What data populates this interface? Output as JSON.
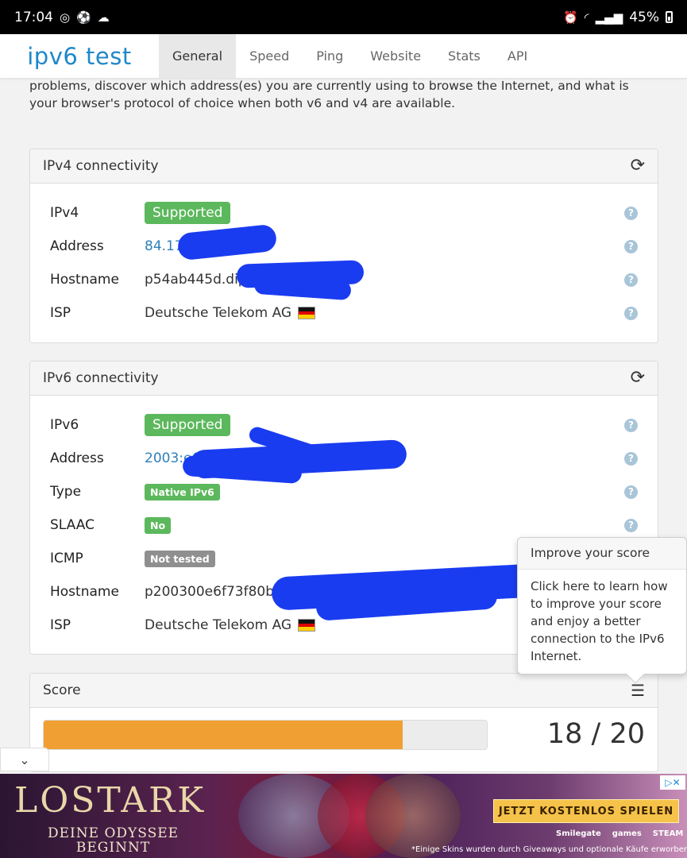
{
  "status": {
    "time": "17:04",
    "battery": "45%"
  },
  "nav": {
    "logo": "ipv6 test",
    "tabs": [
      "General",
      "Speed",
      "Ping",
      "Website",
      "Stats",
      "API"
    ],
    "active_tab": "General"
  },
  "intro": "problems, discover which address(es) you are currently using to browse the Internet, and what is your browser's protocol of choice when both v6 and v4 are available.",
  "ipv4": {
    "title": "IPv4 connectivity",
    "rows": [
      {
        "label": "IPv4",
        "value": "Supported"
      },
      {
        "label": "Address",
        "value": "84.171"
      },
      {
        "label": "Hostname",
        "value": "p54ab445d.dip0.t-"
      },
      {
        "label": "ISP",
        "value": "Deutsche Telekom AG"
      }
    ]
  },
  "ipv6": {
    "title": "IPv6 connectivity",
    "rows": [
      {
        "label": "IPv6",
        "value": "Supported"
      },
      {
        "label": "Address",
        "value": "2003:e6"
      },
      {
        "label": "Type",
        "value": "Native IPv6"
      },
      {
        "label": "SLAAC",
        "value": "No"
      },
      {
        "label": "ICMP",
        "value": "Not tested"
      },
      {
        "label": "Hostname",
        "value": "p200300e6f73f80bde"
      },
      {
        "label": "ISP",
        "value": "Deutsche Telekom AG"
      }
    ]
  },
  "score": {
    "title": "Score",
    "value": 18,
    "max": 20,
    "text": "18 / 20"
  },
  "popover": {
    "title": "Improve your score",
    "body": "Click here to learn how to improve your score and enjoy a better connection to the IPv6 Internet."
  },
  "ad": {
    "brand": "LOSTARK",
    "sub": "DEINE ODYSSEE\nBEGINNT",
    "cta": "JETZT KOSTENLOS SPIELEN",
    "fine": "*Einige Skins wurden durch Giveaways und optionale Käufe erworben.",
    "logos": [
      "Smilegate",
      "games",
      "STEAM"
    ]
  },
  "colors": {
    "accent": "#1f88c9",
    "success": "#5cb85c",
    "progress": "#f0a033",
    "redaction": "#1a3cf0"
  }
}
